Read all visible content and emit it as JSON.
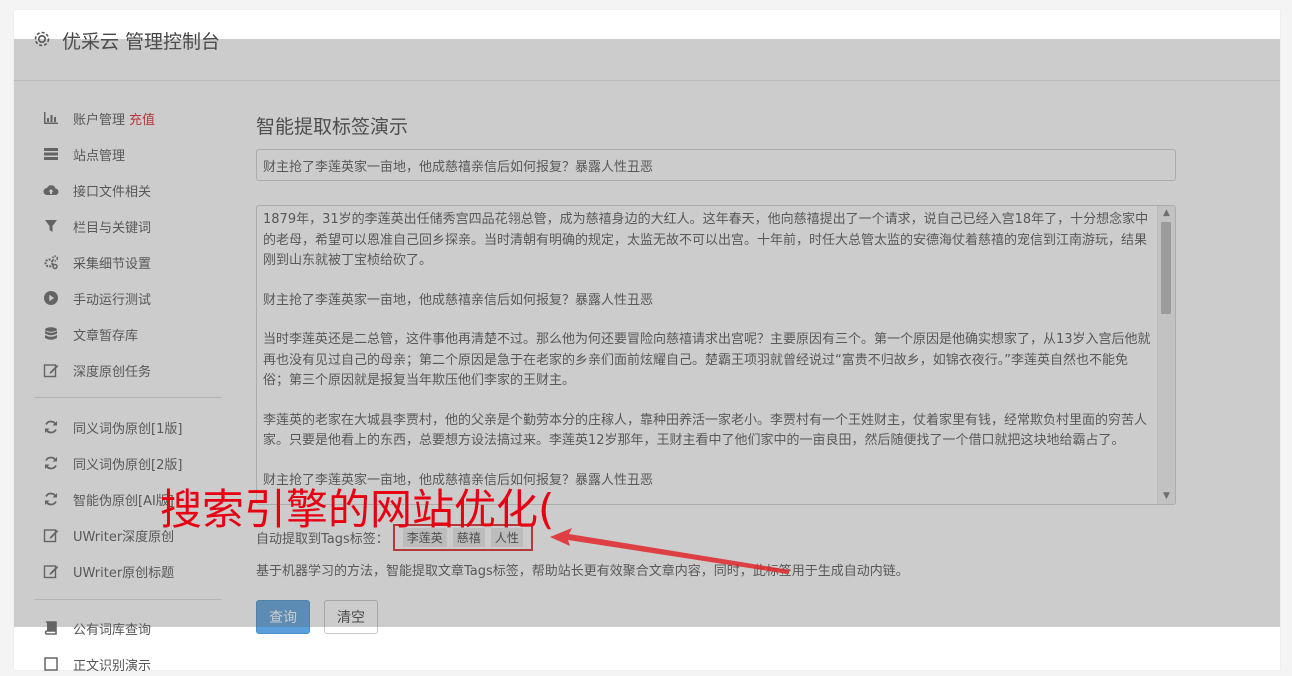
{
  "header": {
    "title": "优采云 管理控制台",
    "icon": "gear-icon"
  },
  "sidebar": {
    "group1": [
      {
        "label": "账户管理",
        "extra": "充值",
        "icon": "bar-chart-icon"
      },
      {
        "label": "站点管理",
        "icon": "server-icon"
      },
      {
        "label": "接口文件相关",
        "icon": "cloud-upload-icon"
      },
      {
        "label": "栏目与关键词",
        "icon": "filter-icon"
      },
      {
        "label": "采集细节设置",
        "icon": "gears-icon"
      },
      {
        "label": "手动运行测试",
        "icon": "play-circle-icon"
      },
      {
        "label": "文章暂存库",
        "icon": "database-icon"
      },
      {
        "label": "深度原创任务",
        "icon": "edit-icon"
      }
    ],
    "group2": [
      {
        "label": "同义词伪原创[1版]",
        "icon": "refresh-icon"
      },
      {
        "label": "同义词伪原创[2版]",
        "icon": "refresh-icon"
      },
      {
        "label": "智能伪原创[AI版]",
        "icon": "refresh-icon"
      },
      {
        "label": "UWriter深度原创",
        "icon": "edit-icon"
      },
      {
        "label": "UWriter原创标题",
        "icon": "edit-icon"
      }
    ],
    "group3": [
      {
        "label": "公有词库查询",
        "icon": "book-icon"
      },
      {
        "label": "正文识别演示",
        "icon": "square-icon"
      }
    ]
  },
  "main": {
    "page_title": "智能提取标签演示",
    "title_input_value": "财主抢了李莲英家一亩地，他成慈禧亲信后如何报复？暴露人性丑恶",
    "content_paragraphs": [
      "1879年，31岁的李莲英出任储秀宫四品花翎总管，成为慈禧身边的大红人。这年春天，他向慈禧提出了一个请求，说自己已经入宫18年了，十分想念家中的老母，希望可以恩准自己回乡探亲。当时清朝有明确的规定，太监无故不可以出宫。十年前，时任大总管太监的安德海仗着慈禧的宠信到江南游玩，结果刚到山东就被丁宝桢给砍了。",
      "财主抢了李莲英家一亩地，他成慈禧亲信后如何报复？暴露人性丑恶",
      "当时李莲英还是二总管，这件事他再清楚不过。那么他为何还要冒险向慈禧请求出宫呢？主要原因有三个。第一个原因是他确实想家了，从13岁入宫后他就再也没有见过自己的母亲；第二个原因是急于在老家的乡亲们面前炫耀自己。楚霸王项羽就曾经说过“富贵不归故乡，如锦衣夜行。”李莲英自然也不能免俗；第三个原因就是报复当年欺压他们李家的王财主。",
      "李莲英的老家在大城县李贾村，他的父亲是个勤劳本分的庄稼人，靠种田养活一家老小。李贾村有一个王姓财主，仗着家里有钱，经常欺负村里面的穷苦人家。只要是他看上的东西，总要想方设法搞过来。李莲英12岁那年，王财主看中了他们家中的一亩良田，然后随便找了一个借口就把这块地给霸占了。",
      "财主抢了李莲英家一亩地，他成慈禧亲信后如何报复？暴露人性丑恶"
    ],
    "tags_label": "自动提取到Tags标签：",
    "tags": [
      "李莲英",
      "慈禧",
      "人性"
    ],
    "help_text": "基于机器学习的方法，智能提取文章Tags标签，帮助站长更有效聚合文章内容，同时，此标签用于生成自动内链。",
    "query_button": "查询",
    "clear_button": "清空"
  },
  "watermark": {
    "text": "搜索引擎的网站优化(",
    "color": "#e60012"
  },
  "colors": {
    "primary_button": "#5a9fdc",
    "highlight_red": "#e0262a"
  }
}
